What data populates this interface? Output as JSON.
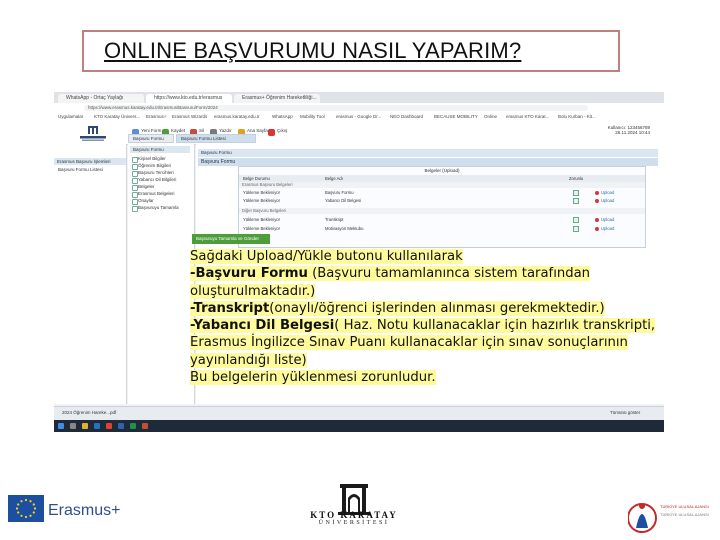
{
  "page_title": "ONLINE BAŞVURUMU NASIL YAPARIM?",
  "browser": {
    "tabs": [
      "WhatsApp - Ortaç Yaylağı",
      "https://www.kto.edu.tr/erasmus",
      "Erasmus+ Öğrenim Hareketliliği..."
    ],
    "address": "https://www.erasmus.karatay.edu.tr/Erasmus/Basvuru/Form/2024",
    "bookmarks": [
      "Uygulamalar",
      "KTO Karatay Ünivers...",
      "Erasmus+",
      "Erasmus Wizards",
      "erasmus.karatay.edu.tr",
      "WhatsApp",
      "erasmus.karatay.edu.tr",
      "Mobility Tool",
      "erasmus - Google Dr...",
      "NEO Dashboard",
      "BECAUSE MOBILITY",
      "Online",
      "erasmus KTO Karat...",
      "Bolu Kurban - Kit..."
    ]
  },
  "app": {
    "logo_name": "KTO KARATAY",
    "logo_sub": "ÜNİVERSİTESİ",
    "toolbar": [
      "Yeni Form",
      "Kaydet",
      "Sil",
      "Yazdır",
      "Ana Sayfa",
      "Çıkış"
    ],
    "user_info": [
      "Kullanıcı: 123456789",
      "26.11.2024 10:44"
    ],
    "top_tabs": [
      "Başvuru Formu",
      "Başvuru Formu Listesi"
    ],
    "left_panel": {
      "header": "Erasmus Başvuru İşlemleri",
      "item": "Başvuru Formu Listesi"
    },
    "mid_panel": {
      "tab": "Başvuru Formu",
      "items": [
        "Kişisel Bilgiler",
        "Öğrenim Bilgileri",
        "Başvuru Tercihleri",
        "Yabancı Dil Bilgileri",
        "Belgeler",
        "Erasmus Belgeleri",
        "Onaylar",
        "Başvuruyu Tamamla"
      ]
    },
    "form": {
      "header": "Başvuru Formu",
      "title": "Başvuru Formu",
      "table_caption": "Belgeler (Upload)",
      "columns": [
        "Belge Durumu",
        "Belge Adı",
        "Zorunlu"
      ],
      "group1": "Erasmus Başvuru Belgeleri",
      "group2": "Diğer Başvuru Belgeleri",
      "rows": [
        {
          "status": "Yükleme Bekleniyor",
          "name": "Başvuru Formu",
          "upload": "Upload"
        },
        {
          "status": "Yükleme Bekleniyor",
          "name": "Yabancı Dil Belgesi",
          "upload": "Upload"
        },
        {
          "status": "Yükleme Bekleniyor",
          "name": "Transkript",
          "upload": "Upload"
        },
        {
          "status": "Yükleme Bekleniyor",
          "name": "Motivasyon Mektubu",
          "upload": "Upload"
        }
      ],
      "submit": "Başvuruyu Tamamla ve Gönder"
    }
  },
  "callout": {
    "line1": "Sağdaki Upload/Yükle butonu kullanılarak",
    "line2_bold": "-Başvuru Formu",
    "line2_rest": " (Başvuru tamamlanınca sistem tarafından",
    "line3": "oluşturulmaktadır.)",
    "line4_bold": "-Transkript",
    "line4_rest": "(onaylı/öğrenci işlerinden alınması gerekmektedir.)",
    "line5_bold": "-Yabancı Dil Belgesi",
    "line5_rest": "( Haz. Notu kullanacaklar için hazırlık transkripti,",
    "line6": "Erasmus İngilizce Sınav Puanı kullanacaklar için sınav sonuçlarının",
    "line7": "yayınlandığı liste)",
    "line8": "Bu belgelerin yüklenmesi zorunludur."
  },
  "taskbar": {
    "download_item": "2024 Öğrenim Hareke...pdf",
    "show_all": "Tümünü göster"
  },
  "footer": {
    "erasmus": "Erasmus+",
    "kto_name": "KTO KARATAY",
    "kto_sub": "ÜNİVERSİTESİ",
    "tr_line1": "TÜRKİYE ULUSAL AJANSI",
    "tr_line2": "TÜRKİYE ULUSAL AJANSI"
  },
  "colors": {
    "callout_bg": "#fffb9d",
    "submit_bg": "#4d9e3a",
    "eu_blue": "#1d4fa0"
  }
}
